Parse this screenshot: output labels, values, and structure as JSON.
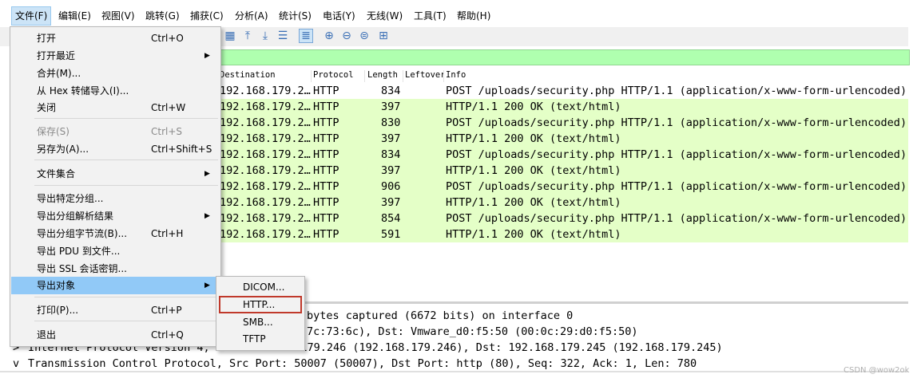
{
  "menubar": {
    "items": [
      "文件(F)",
      "编辑(E)",
      "视图(V)",
      "跳转(G)",
      "捕获(C)",
      "分析(A)",
      "统计(S)",
      "电话(Y)",
      "无线(W)",
      "工具(T)",
      "帮助(H)"
    ]
  },
  "toolbar": {
    "icons": [
      "colorize-icon",
      "go-first-icon",
      "go-last-icon",
      "autoscroll-icon",
      "colorize-list-icon",
      "zoom-in-icon",
      "zoom-out-icon",
      "zoom-normal-icon",
      "resize-columns-icon"
    ]
  },
  "packet_list": {
    "columns": [
      "Destination",
      "Protocol",
      "Length",
      "Leftover",
      "Info"
    ],
    "rows": [
      {
        "dst": "192.168.179.2…",
        "proto": "HTTP",
        "len": "834",
        "info": "POST /uploads/security.php HTTP/1.1  (application/x-www-form-urlencoded)"
      },
      {
        "dst": "192.168.179.2…",
        "proto": "HTTP",
        "len": "397",
        "info": "HTTP/1.1 200 OK  (text/html)"
      },
      {
        "dst": "192.168.179.2…",
        "proto": "HTTP",
        "len": "830",
        "info": "POST /uploads/security.php HTTP/1.1  (application/x-www-form-urlencoded)"
      },
      {
        "dst": "192.168.179.2…",
        "proto": "HTTP",
        "len": "397",
        "info": "HTTP/1.1 200 OK  (text/html)"
      },
      {
        "dst": "192.168.179.2…",
        "proto": "HTTP",
        "len": "834",
        "info": "POST /uploads/security.php HTTP/1.1  (application/x-www-form-urlencoded)"
      },
      {
        "dst": "192.168.179.2…",
        "proto": "HTTP",
        "len": "397",
        "info": "HTTP/1.1 200 OK  (text/html)"
      },
      {
        "dst": "192.168.179.2…",
        "proto": "HTTP",
        "len": "906",
        "info": "POST /uploads/security.php HTTP/1.1  (application/x-www-form-urlencoded)"
      },
      {
        "dst": "192.168.179.2…",
        "proto": "HTTP",
        "len": "397",
        "info": "HTTP/1.1 200 OK  (text/html)"
      },
      {
        "dst": "192.168.179.2…",
        "proto": "HTTP",
        "len": "854",
        "info": "POST /uploads/security.php HTTP/1.1  (application/x-www-form-urlencoded)"
      },
      {
        "dst": "192.168.179.2…",
        "proto": "HTTP",
        "len": "591",
        "info": "HTTP/1.1 200 OK  (text/html)"
      }
    ]
  },
  "details": {
    "line1": "bytes captured (6672 bits) on interface 0",
    "line2": "7c:73:6c), Dst: Vmware_d0:f5:50 (00:0c:29:d0:f5:50)",
    "line3": "Internet Protocol Version 4, Src: 192.168.179.246 (192.168.179.246), Dst: 192.168.179.245 (192.168.179.245)",
    "line4": "Transmission Control Protocol, Src Port: 50007 (50007), Dst Port: http (80), Seq: 322, Ack: 1, Len: 780",
    "expand_collapsed": ">",
    "expand_open": "v"
  },
  "file_menu": {
    "open": {
      "label": "打开",
      "shortcut": "Ctrl+O"
    },
    "recent": {
      "label": "打开最近"
    },
    "merge": {
      "label": "合并(M)..."
    },
    "import_hex": {
      "label": "从 Hex 转储导入(I)..."
    },
    "close": {
      "label": "关闭",
      "shortcut": "Ctrl+W"
    },
    "save": {
      "label": "保存(S)",
      "shortcut": "Ctrl+S"
    },
    "save_as": {
      "label": "另存为(A)...",
      "shortcut": "Ctrl+Shift+S"
    },
    "file_set": {
      "label": "文件集合"
    },
    "export_specified": {
      "label": "导出特定分组..."
    },
    "export_dissections": {
      "label": "导出分组解析结果"
    },
    "export_bytes": {
      "label": "导出分组字节流(B)...",
      "shortcut": "Ctrl+H"
    },
    "export_pdu": {
      "label": "导出 PDU 到文件..."
    },
    "export_ssl": {
      "label": "导出 SSL 会话密钥..."
    },
    "export_objects": {
      "label": "导出对象"
    },
    "print": {
      "label": "打印(P)...",
      "shortcut": "Ctrl+P"
    },
    "quit": {
      "label": "退出",
      "shortcut": "Ctrl+Q"
    },
    "submenu_arrow": "▶"
  },
  "export_objects_submenu": {
    "dicom": "DICOM...",
    "http": "HTTP...",
    "smb": "SMB...",
    "tftp": "TFTP"
  },
  "watermark": "CSDN @wow2ok"
}
